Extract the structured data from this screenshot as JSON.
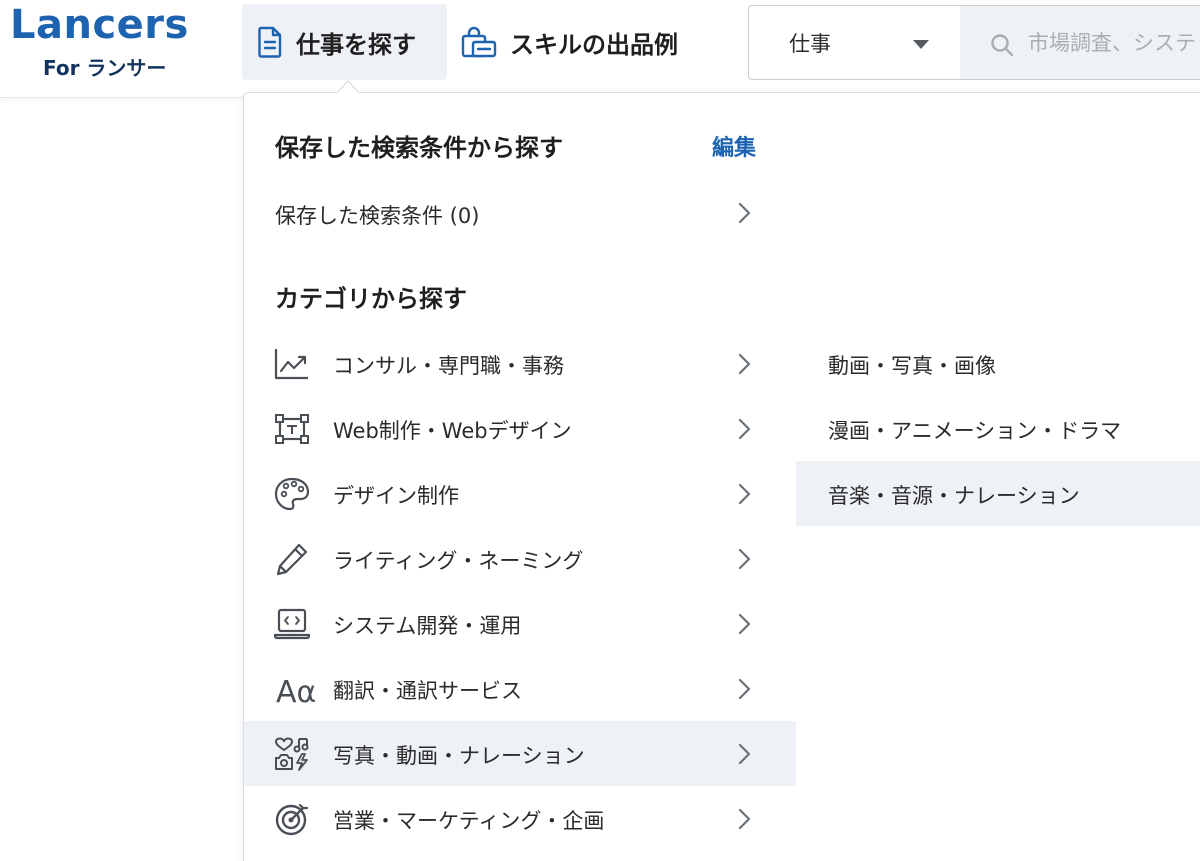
{
  "header": {
    "logo_main": "Lancers",
    "logo_sub": "For ランサー",
    "nav": {
      "find_jobs": "仕事を探す",
      "skill_examples": "スキルの出品例"
    },
    "search": {
      "category_value": "仕事",
      "placeholder": "市場調査、システ"
    }
  },
  "dropdown": {
    "saved_section_title": "保存した検索条件から探す",
    "edit_label": "編集",
    "saved_item_label": "保存した検索条件 (0)",
    "category_section_title": "カテゴリから探す",
    "categories": [
      {
        "label": "コンサル・専門職・事務",
        "icon": "chart-trend-icon"
      },
      {
        "label": "Web制作・Webデザイン",
        "icon": "layout-frame-icon"
      },
      {
        "label": "デザイン制作",
        "icon": "palette-icon"
      },
      {
        "label": "ライティング・ネーミング",
        "icon": "pencil-icon"
      },
      {
        "label": "システム開発・運用",
        "icon": "laptop-code-icon"
      },
      {
        "label": "翻訳・通訳サービス",
        "icon": "translate-icon"
      },
      {
        "label": "写真・動画・ナレーション",
        "icon": "media-icon"
      },
      {
        "label": "営業・マーケティング・企画",
        "icon": "target-icon"
      }
    ],
    "active_category_index": 6,
    "subcategories": [
      {
        "label": "動画・写真・画像"
      },
      {
        "label": "漫画・アニメーション・ドラマ"
      },
      {
        "label": "音楽・音源・ナレーション"
      }
    ],
    "active_subcategory_index": 2
  },
  "colors": {
    "brand_blue": "#1d63b0",
    "brand_navy": "#12335e",
    "highlight_bg": "#eef1f5"
  }
}
